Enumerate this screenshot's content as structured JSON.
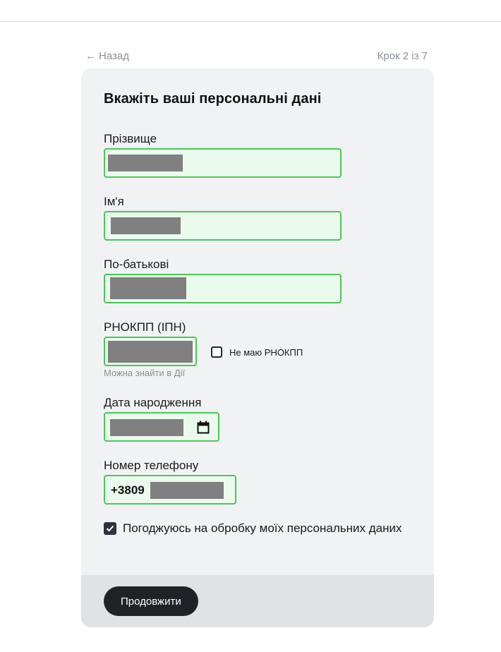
{
  "nav": {
    "back_arrow": "←",
    "back_label": "Назад",
    "step": "Крок 2 із 7"
  },
  "form": {
    "title": "Вкажіть ваші персональні дані",
    "surname_label": "Прізвище",
    "name_label": "Ім'я",
    "patronymic_label": "По-батькові",
    "rnokpp_label": "РНОКПП (ІПН)",
    "rnokpp_hint": "Можна знайти в Дії",
    "no_rnokpp_label": "Не маю РНОКПП",
    "birthdate_label": "Дата народження",
    "phone_label": "Номер телефону",
    "phone_prefix": "+3809",
    "consent_label": "Погоджуюсь на обробку моїх персональних даних",
    "consent_checked": true,
    "no_rnokpp_checked": false,
    "continue_label": "Продовжити"
  },
  "colors": {
    "field_border": "#4cc65a",
    "field_bg": "#eafaec",
    "button_bg": "#1f2227",
    "card_bg": "#f1f2f4",
    "redaction": "#808080"
  },
  "icons": {
    "back": "arrow-left-icon",
    "calendar": "calendar-icon",
    "check": "check-icon"
  }
}
